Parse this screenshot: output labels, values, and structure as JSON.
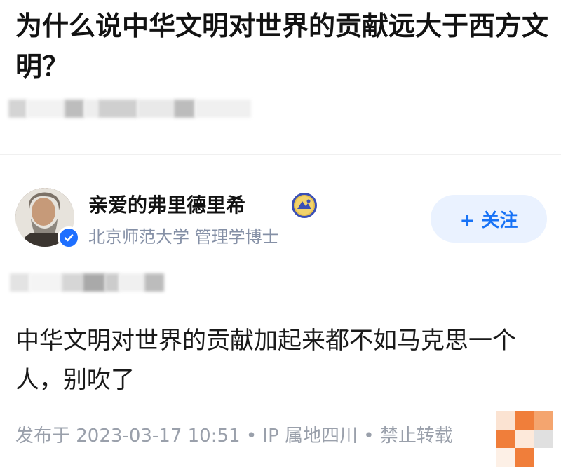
{
  "question": {
    "title": "为什么说中华文明对世界的贡献远大于西方文明？"
  },
  "author": {
    "name": "亲爱的弗里德里希",
    "bio": "北京师范大学 管理学博士",
    "avatar_icon": "portrait-avatar-icon",
    "verified_icon": "verified-check-icon",
    "badge_icon": "creator-badge-icon"
  },
  "follow_button": {
    "label": "+ 关注"
  },
  "answer": {
    "content": "中华文明对世界的贡献加起来都不如马克思一个人，别吹了"
  },
  "footer": {
    "meta": "发布于 2023-03-17 10:51 • IP 属地四川 • 禁止转载"
  },
  "colors": {
    "accent": "#1772f6",
    "follow_bg": "#eaf2ff",
    "meta_text": "#9aa0ab",
    "verified": "#1e6fff",
    "mosaic_orange": "#f07e3a"
  }
}
